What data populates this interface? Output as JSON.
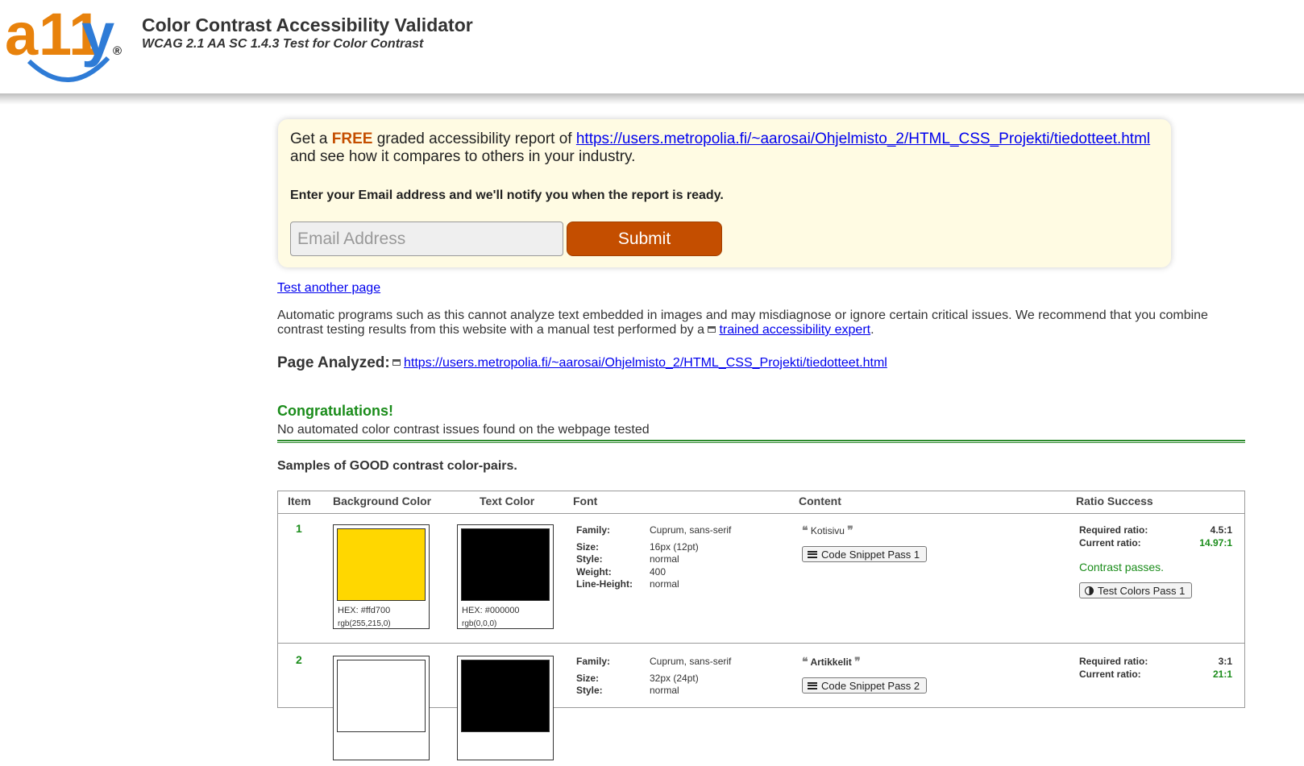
{
  "header": {
    "logo_text": "a11y",
    "logo_mark": "®",
    "title": "Color Contrast Accessibility Validator",
    "subtitle": "WCAG 2.1 AA SC 1.4.3 Test for Color Contrast"
  },
  "promo": {
    "prefix": "Get a ",
    "free": "FREE",
    "middle": " graded accessibility report of ",
    "url": "https://users.metropolia.fi/~aarosai/Ohjelmisto_2/HTML_CSS_Projekti/tiedotteet.html",
    "suffix": "and see how it compares to others in your industry.",
    "email_label": "Enter your Email address and we'll notify you when the report is ready.",
    "email_placeholder": "Email Address",
    "submit_label": "Submit"
  },
  "test_another": "Test another page",
  "disclaimer": {
    "text": "Automatic programs such as this cannot analyze text embedded in images and may misdiagnose or ignore certain critical issues. We recommend that you combine contrast testing results from this website with a manual test performed by a ",
    "link": "trained accessibility expert",
    "end": "."
  },
  "page_analyzed": {
    "label": "Page Analyzed:",
    "url": "https://users.metropolia.fi/~aarosai/Ohjelmisto_2/HTML_CSS_Projekti/tiedotteet.html"
  },
  "result": {
    "heading": "Congratulations!",
    "message": "No automated color contrast issues found on the webpage tested"
  },
  "samples_heading": "Samples of GOOD contrast color-pairs.",
  "table": {
    "headers": [
      "Item",
      "Background Color",
      "Text Color",
      "Font",
      "Content",
      "Ratio Success"
    ],
    "font_labels": {
      "family": "Family:",
      "size": "Size:",
      "style": "Style:",
      "weight": "Weight:",
      "line_height": "Line-Height:"
    },
    "ratio_labels": {
      "required": "Required ratio:",
      "current": "Current ratio:"
    },
    "rows": [
      {
        "item": "1",
        "bg_hex": "HEX: #ffd700",
        "bg_rgb": "rgb(255,215,0)",
        "bg_color": "#ffd700",
        "text_hex": "HEX: #000000",
        "text_rgb": "rgb(0,0,0)",
        "text_color": "#000000",
        "family": "Cuprum, sans-serif",
        "size": "16px (12pt)",
        "style": "normal",
        "weight": "400",
        "line_height": "normal",
        "content": "Kotisivu",
        "snippet_button": "Code Snippet Pass 1",
        "required_ratio": "4.5:1",
        "current_ratio": "14.97:1",
        "status": "Contrast passes.",
        "test_button": "Test Colors Pass 1"
      },
      {
        "item": "2",
        "bg_color": "#ffffff",
        "text_color": "#000000",
        "family": "Cuprum, sans-serif",
        "size": "32px (24pt)",
        "style": "normal",
        "content": "Artikkelit",
        "snippet_button": "Code Snippet Pass 2",
        "required_ratio": "3:1",
        "current_ratio": "21:1"
      }
    ]
  },
  "colors": {
    "accent_orange": "#c44e00",
    "pass_green": "#1a8c1a",
    "promo_bg": "#fffbe3",
    "logo_blue": "#2e7bd6",
    "logo_orange": "#e8820c"
  }
}
